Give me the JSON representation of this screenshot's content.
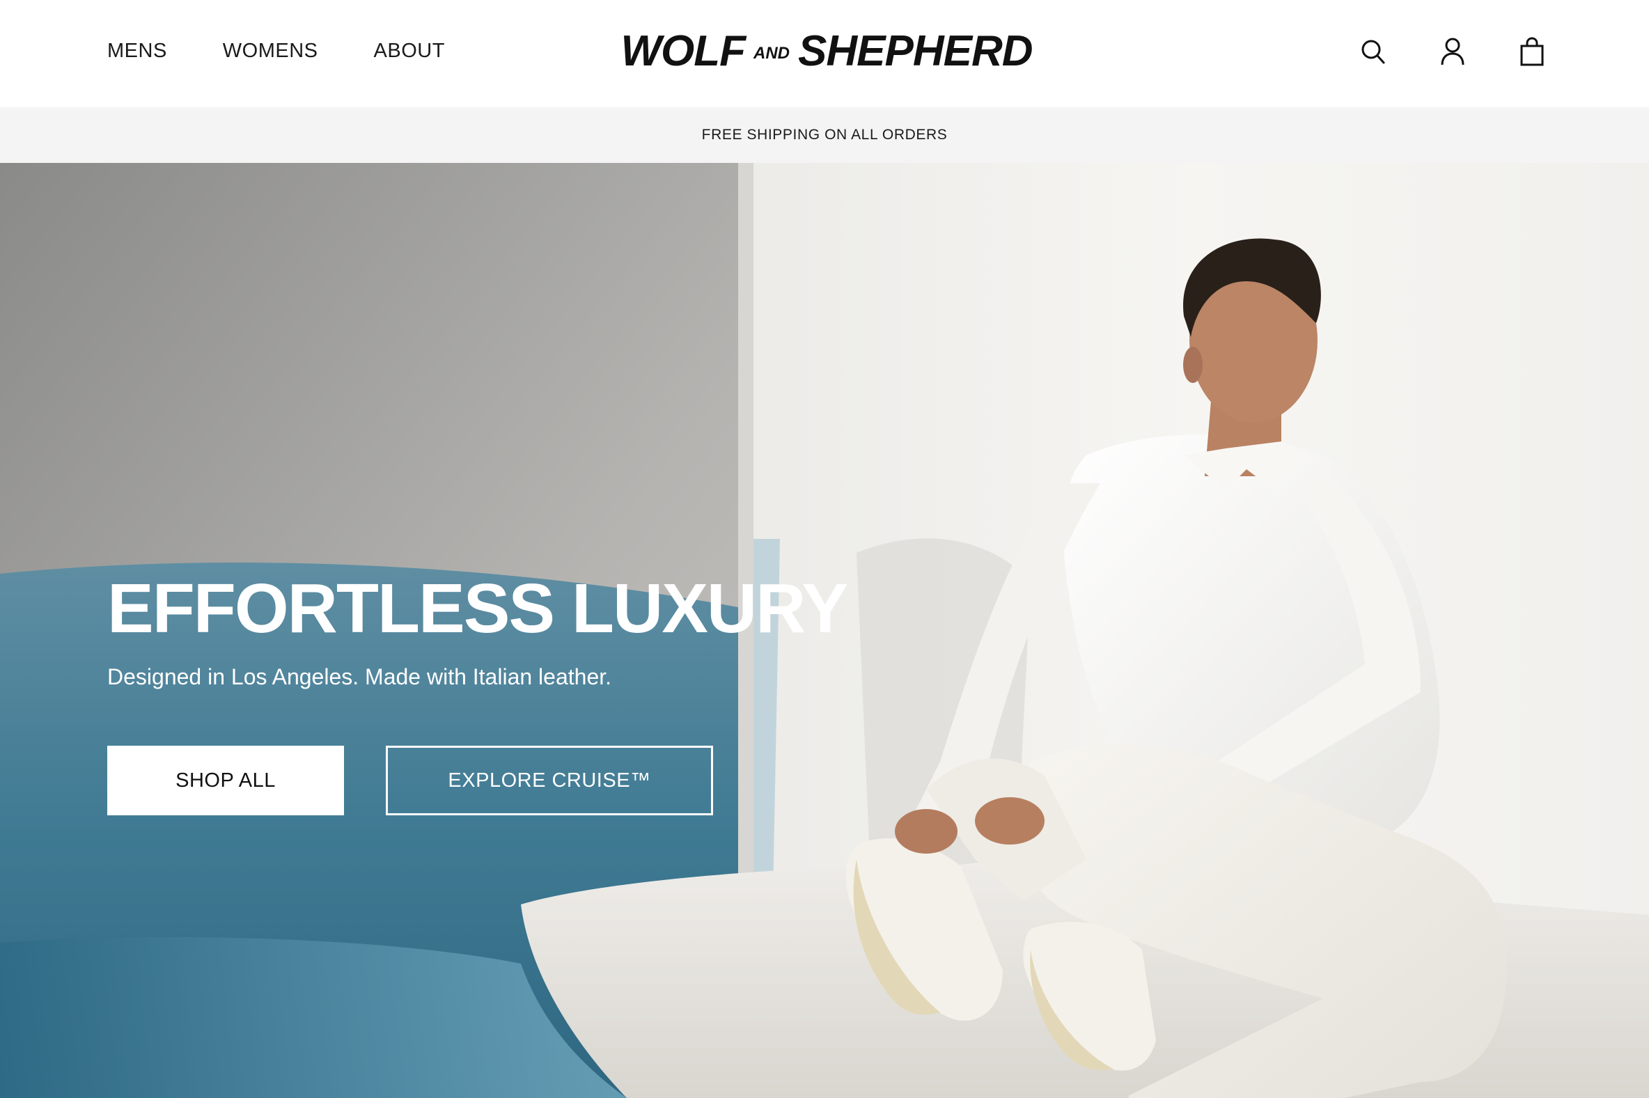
{
  "header": {
    "nav": [
      {
        "label": "MENS"
      },
      {
        "label": "WOMENS"
      },
      {
        "label": "ABOUT"
      }
    ],
    "logo": {
      "part1": "WOLF",
      "and": "AND",
      "part2": "SHEPHERD"
    },
    "icons": [
      "search-icon",
      "account-icon",
      "shopping-bag-icon"
    ]
  },
  "announcement": {
    "text": "FREE SHIPPING ON ALL ORDERS"
  },
  "hero": {
    "title": "EFFORTLESS LUXURY",
    "subtitle": "Designed in Los Angeles. Made with Italian leather.",
    "primary_button": "SHOP ALL",
    "secondary_button": "EXPLORE CRUISE™"
  },
  "colors": {
    "text": "#111111",
    "announcement_bg": "#f4f4f4",
    "pool_blue": "#3d7f99",
    "wall_white": "#f3f2ef"
  }
}
